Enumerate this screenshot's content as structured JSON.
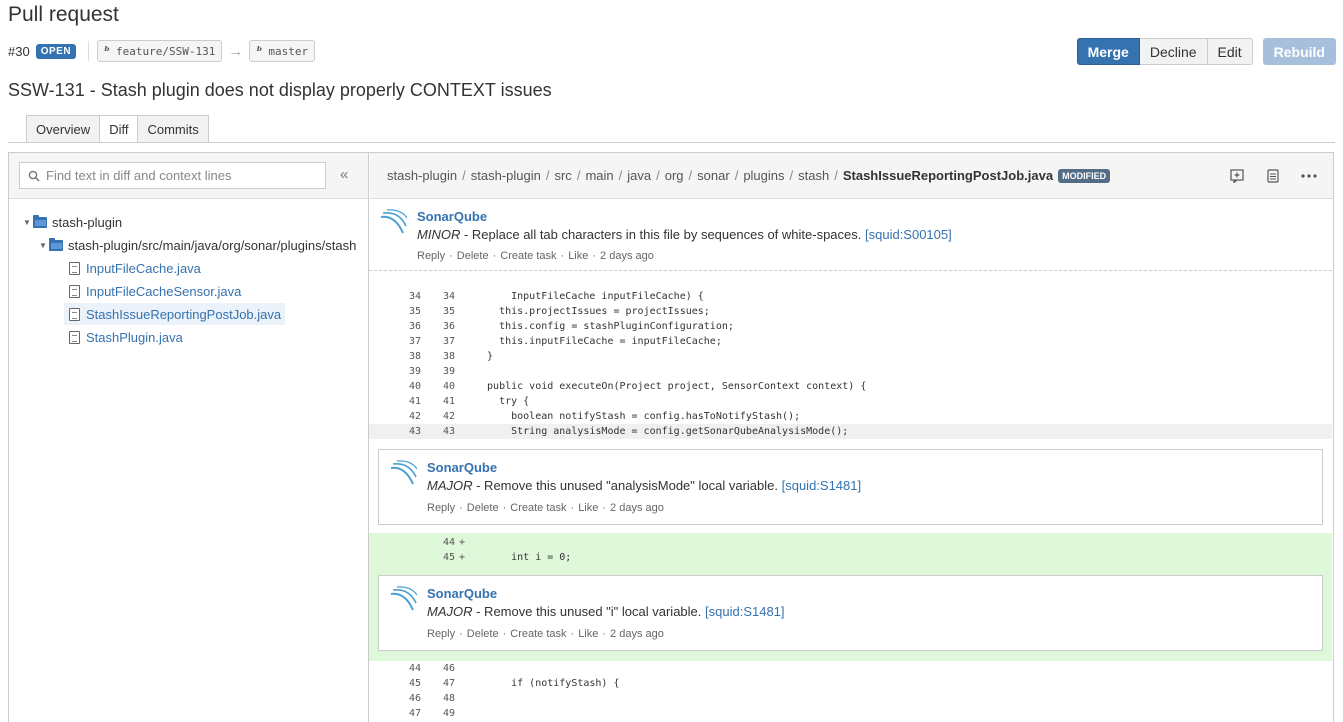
{
  "page": {
    "title": "Pull request"
  },
  "pr": {
    "number": "#30",
    "status": "OPEN",
    "source_branch": "feature/SSW-131",
    "target_branch": "master",
    "title": "SSW-131 - Stash plugin does not display properly CONTEXT issues"
  },
  "actions": {
    "merge": "Merge",
    "decline": "Decline",
    "edit": "Edit",
    "rebuild": "Rebuild"
  },
  "tabs": [
    {
      "label": "Overview"
    },
    {
      "label": "Diff"
    },
    {
      "label": "Commits"
    }
  ],
  "sidebar": {
    "search_placeholder": "Find text in diff and context lines",
    "collapse_label": "«",
    "tree": {
      "root": "stash-plugin",
      "folder": "stash-plugin/src/main/java/org/sonar/plugins/stash",
      "files": [
        "InputFileCache.java",
        "InputFileCacheSensor.java",
        "StashIssueReportingPostJob.java",
        "StashPlugin.java"
      ]
    }
  },
  "diff_header": {
    "crumbs": [
      "stash-plugin",
      "stash-plugin",
      "src",
      "main",
      "java",
      "org",
      "sonar",
      "plugins",
      "stash"
    ],
    "separator": "/",
    "file": "StashIssueReportingPostJob.java",
    "badge": "MODIFIED"
  },
  "comments": {
    "file_comment": {
      "author": "SonarQube",
      "severity": "MINOR",
      "text": " - Replace all tab characters in this file by sequences of white-spaces. ",
      "rule": "[squid:S00105]",
      "actions": [
        "Reply",
        "Delete",
        "Create task",
        "Like",
        "2 days ago"
      ]
    },
    "comment_1": {
      "author": "SonarQube",
      "severity": "MAJOR",
      "text": " - Remove this unused \"analysisMode\" local variable. ",
      "rule": "[squid:S1481]",
      "actions": [
        "Reply",
        "Delete",
        "Create task",
        "Like",
        "2 days ago"
      ]
    },
    "comment_2": {
      "author": "SonarQube",
      "severity": "MAJOR",
      "text": " - Remove this unused \"i\" local variable. ",
      "rule": "[squid:S1481]",
      "actions": [
        "Reply",
        "Delete",
        "Create task",
        "Like",
        "2 days ago"
      ]
    }
  },
  "code_blocks": {
    "context_1": [
      {
        "old": "34",
        "new": "34",
        "code": "      InputFileCache inputFileCache) {"
      },
      {
        "old": "35",
        "new": "35",
        "code": "    this.projectIssues = projectIssues;"
      },
      {
        "old": "36",
        "new": "36",
        "code": "    this.config = stashPluginConfiguration;"
      },
      {
        "old": "37",
        "new": "37",
        "code": "    this.inputFileCache = inputFileCache;"
      },
      {
        "old": "38",
        "new": "38",
        "code": "  }"
      },
      {
        "old": "39",
        "new": "39",
        "code": ""
      },
      {
        "old": "40",
        "new": "40",
        "code": "  public void executeOn(Project project, SensorContext context) {"
      },
      {
        "old": "41",
        "new": "41",
        "code": "    try {"
      },
      {
        "old": "42",
        "new": "42",
        "code": "      boolean notifyStash = config.hasToNotifyStash();"
      },
      {
        "old": "43",
        "new": "43",
        "code": "      String analysisMode = config.getSonarQubeAnalysisMode();"
      }
    ],
    "added": [
      {
        "old": "",
        "new": "44",
        "marker": "+",
        "code": ""
      },
      {
        "old": "",
        "new": "45",
        "marker": "+",
        "code": "      int i = 0;"
      }
    ],
    "context_2": [
      {
        "old": "44",
        "new": "46",
        "code": ""
      },
      {
        "old": "45",
        "new": "47",
        "code": "      if (notifyStash) {"
      },
      {
        "old": "46",
        "new": "48",
        "code": ""
      },
      {
        "old": "47",
        "new": "49",
        "code": ""
      }
    ]
  },
  "icons": {
    "folder": "folder-icon",
    "file": "file-icon",
    "branch": "branch-icon",
    "search": "search-icon",
    "add_comment": "add-comment-icon",
    "view_file": "file-view-icon",
    "more": "more-icon",
    "avatar": "sonarqube-logo-icon"
  },
  "colors": {
    "accent": "#3572b0",
    "added_bg": "#dff8d9",
    "rebuild_disabled": "#a6c0db"
  }
}
